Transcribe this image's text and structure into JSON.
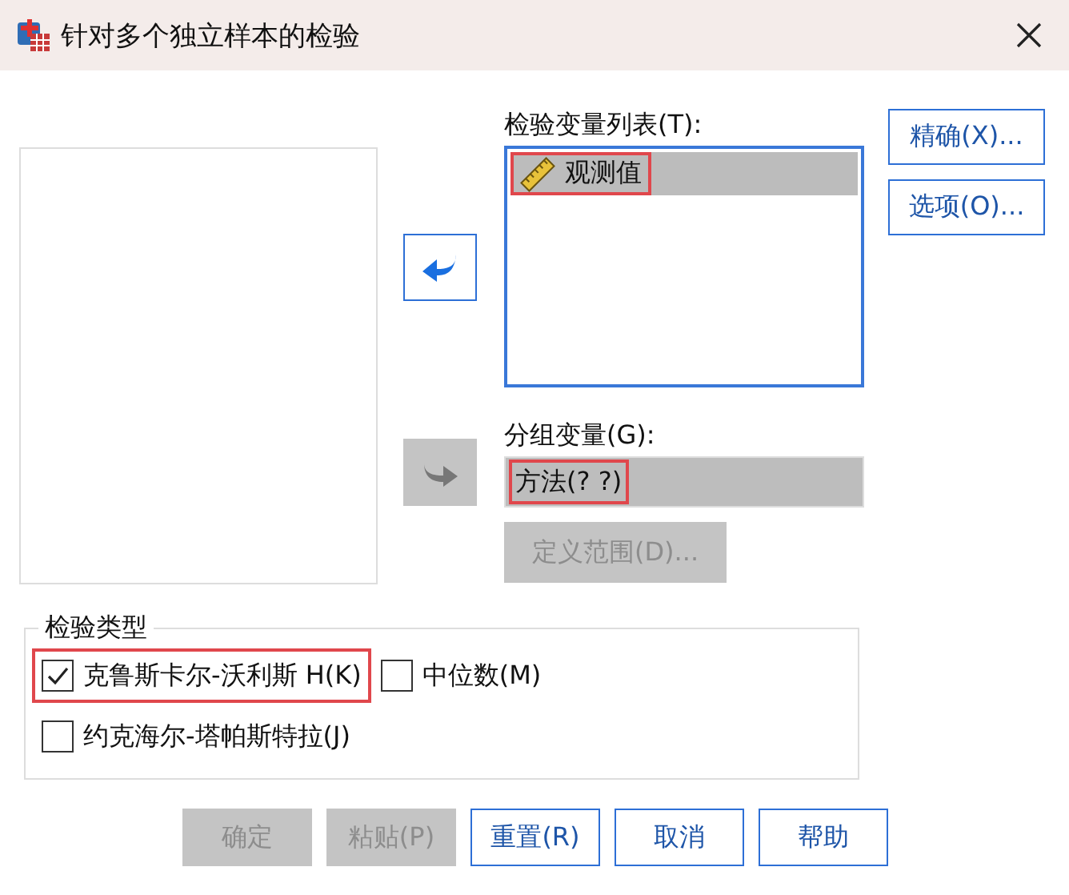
{
  "window": {
    "title": "针对多个独立样本的检验"
  },
  "test_variables": {
    "label": "检验变量列表(T):",
    "items": [
      {
        "name": "观测值",
        "selected": true,
        "highlighted": true
      }
    ]
  },
  "move_buttons": [
    {
      "kind": "left",
      "disabled": false
    },
    {
      "kind": "right",
      "disabled": true
    }
  ],
  "grouping_variable": {
    "label": "分组变量(G):",
    "value": "方法(? ?)",
    "highlighted": true
  },
  "define_range": {
    "label": "定义范围(D)...",
    "disabled": true
  },
  "side_buttons": [
    {
      "label": "精确(X)..."
    },
    {
      "label": "选项(O)..."
    }
  ],
  "test_type": {
    "legend": "检验类型",
    "options": [
      {
        "label": "克鲁斯卡尔-沃利斯 H(K)",
        "checked": true,
        "highlighted": true
      },
      {
        "label": "中位数(M)",
        "checked": false,
        "highlighted": false
      },
      {
        "label": "约克海尔-塔帕斯特拉(J)",
        "checked": false,
        "highlighted": false
      }
    ]
  },
  "buttons": [
    {
      "label": "确定",
      "disabled": true
    },
    {
      "label": "粘贴(P)",
      "disabled": true
    },
    {
      "label": "重置(R)",
      "disabled": false
    },
    {
      "label": "取消",
      "disabled": false
    },
    {
      "label": "帮助",
      "disabled": false
    }
  ]
}
